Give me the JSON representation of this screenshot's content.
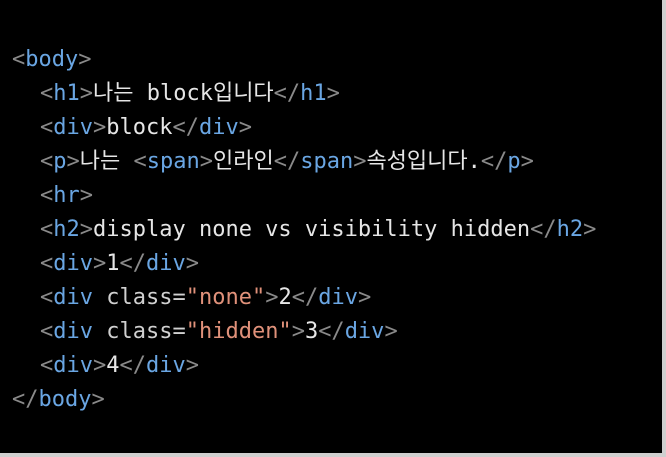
{
  "code": {
    "lines": [
      {
        "indent": 0,
        "tokens": [
          [
            "ang",
            "<"
          ],
          [
            "tag",
            "body"
          ],
          [
            "ang",
            ">"
          ]
        ]
      },
      {
        "indent": 1,
        "tokens": [
          [
            "ang",
            "<"
          ],
          [
            "tag",
            "h1"
          ],
          [
            "ang",
            ">"
          ],
          [
            "txt",
            "나는 block입니다"
          ],
          [
            "ang",
            "</"
          ],
          [
            "tag",
            "h1"
          ],
          [
            "ang",
            ">"
          ]
        ]
      },
      {
        "indent": 1,
        "tokens": [
          [
            "ang",
            "<"
          ],
          [
            "tag",
            "div"
          ],
          [
            "ang",
            ">"
          ],
          [
            "txt",
            "block"
          ],
          [
            "ang",
            "</"
          ],
          [
            "tag",
            "div"
          ],
          [
            "ang",
            ">"
          ]
        ]
      },
      {
        "indent": 1,
        "tokens": [
          [
            "ang",
            "<"
          ],
          [
            "tag",
            "p"
          ],
          [
            "ang",
            ">"
          ],
          [
            "txt",
            "나는 "
          ],
          [
            "ang",
            "<"
          ],
          [
            "tag",
            "span"
          ],
          [
            "ang",
            ">"
          ],
          [
            "txt",
            "인라인"
          ],
          [
            "ang",
            "</"
          ],
          [
            "tag",
            "span"
          ],
          [
            "ang",
            ">"
          ],
          [
            "txt",
            "속성입니다."
          ],
          [
            "ang",
            "</"
          ],
          [
            "tag",
            "p"
          ],
          [
            "ang",
            ">"
          ]
        ]
      },
      {
        "indent": 1,
        "tokens": [
          [
            "ang",
            "<"
          ],
          [
            "tag",
            "hr"
          ],
          [
            "ang",
            ">"
          ]
        ]
      },
      {
        "indent": 1,
        "tokens": [
          [
            "ang",
            "<"
          ],
          [
            "tag",
            "h2"
          ],
          [
            "ang",
            ">"
          ],
          [
            "txt",
            "display none vs visibility hidden"
          ],
          [
            "ang",
            "</"
          ],
          [
            "tag",
            "h2"
          ],
          [
            "ang",
            ">"
          ]
        ]
      },
      {
        "indent": 1,
        "tokens": [
          [
            "ang",
            "<"
          ],
          [
            "tag",
            "div"
          ],
          [
            "ang",
            ">"
          ],
          [
            "txt",
            "1"
          ],
          [
            "ang",
            "</"
          ],
          [
            "tag",
            "div"
          ],
          [
            "ang",
            ">"
          ]
        ]
      },
      {
        "indent": 1,
        "tokens": [
          [
            "ang",
            "<"
          ],
          [
            "tag",
            "div"
          ],
          [
            "attr",
            " class="
          ],
          [
            "str",
            "\"none\""
          ],
          [
            "ang",
            ">"
          ],
          [
            "txt",
            "2"
          ],
          [
            "ang",
            "</"
          ],
          [
            "tag",
            "div"
          ],
          [
            "ang",
            ">"
          ]
        ]
      },
      {
        "indent": 1,
        "tokens": [
          [
            "ang",
            "<"
          ],
          [
            "tag",
            "div"
          ],
          [
            "attr",
            " class="
          ],
          [
            "str",
            "\"hidden\""
          ],
          [
            "ang",
            ">"
          ],
          [
            "txt",
            "3"
          ],
          [
            "ang",
            "</"
          ],
          [
            "tag",
            "div"
          ],
          [
            "ang",
            ">"
          ]
        ]
      },
      {
        "indent": 1,
        "tokens": [
          [
            "ang",
            "<"
          ],
          [
            "tag",
            "div"
          ],
          [
            "ang",
            ">"
          ],
          [
            "txt",
            "4"
          ],
          [
            "ang",
            "</"
          ],
          [
            "tag",
            "div"
          ],
          [
            "ang",
            ">"
          ]
        ]
      },
      {
        "indent": 0,
        "tokens": [
          [
            "ang",
            "</"
          ],
          [
            "tag",
            "body"
          ],
          [
            "ang",
            ">"
          ]
        ]
      }
    ]
  },
  "colors": {
    "background": "#000000",
    "tag": "#6aa6e3",
    "angle_bracket": "#8a8a8a",
    "text": "#e6e6e6",
    "attribute": "#d0d0d0",
    "string": "#e0917a"
  }
}
